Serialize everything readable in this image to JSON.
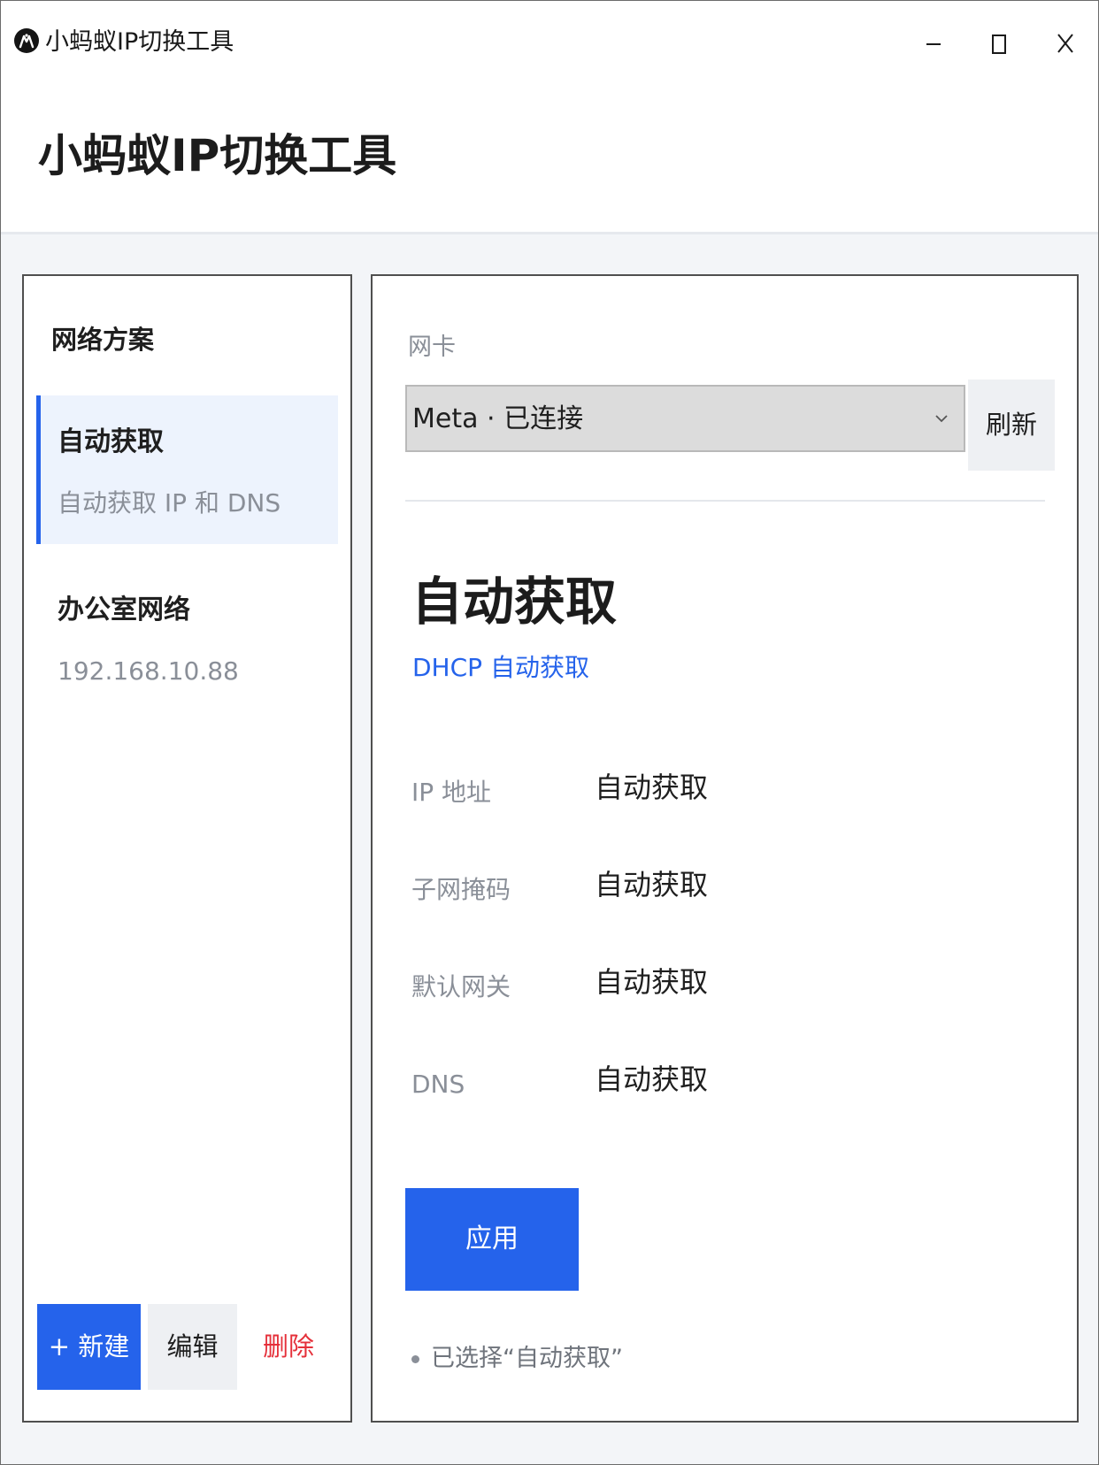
{
  "window": {
    "title": "小蚂蚁IP切换工具",
    "controls": {
      "minimize": "minimize",
      "maximize": "maximize",
      "close": "close"
    }
  },
  "header": {
    "title": "小蚂蚁IP切换工具"
  },
  "sidebar": {
    "heading": "网络方案",
    "profiles": [
      {
        "name": "自动获取",
        "description": "自动获取 IP 和 DNS",
        "selected": true
      },
      {
        "name": "办公室网络",
        "description": "192.168.10.88",
        "selected": false
      }
    ],
    "actions": {
      "new_label": "+ 新建",
      "edit_label": "编辑",
      "delete_label": "删除"
    }
  },
  "main": {
    "adapter": {
      "label": "网卡",
      "selected_value": "Meta · 已连接",
      "refresh_label": "刷新"
    },
    "detail": {
      "title": "自动获取",
      "mode": "DHCP 自动获取",
      "fields": [
        {
          "label": "IP 地址",
          "value": "自动获取"
        },
        {
          "label": "子网掩码",
          "value": "自动获取"
        },
        {
          "label": "默认网关",
          "value": "自动获取"
        },
        {
          "label": "DNS",
          "value": "自动获取"
        }
      ]
    },
    "apply_label": "应用",
    "status_text": "已选择“自动获取”"
  },
  "colors": {
    "accent": "#2563eb",
    "danger": "#e5303a",
    "selected_bg": "#edf3fd",
    "muted_text": "#8a8f98"
  },
  "icons": {
    "app": "ant-logo-icon",
    "dropdown": "chevron-down-icon",
    "status": "dot-icon"
  }
}
